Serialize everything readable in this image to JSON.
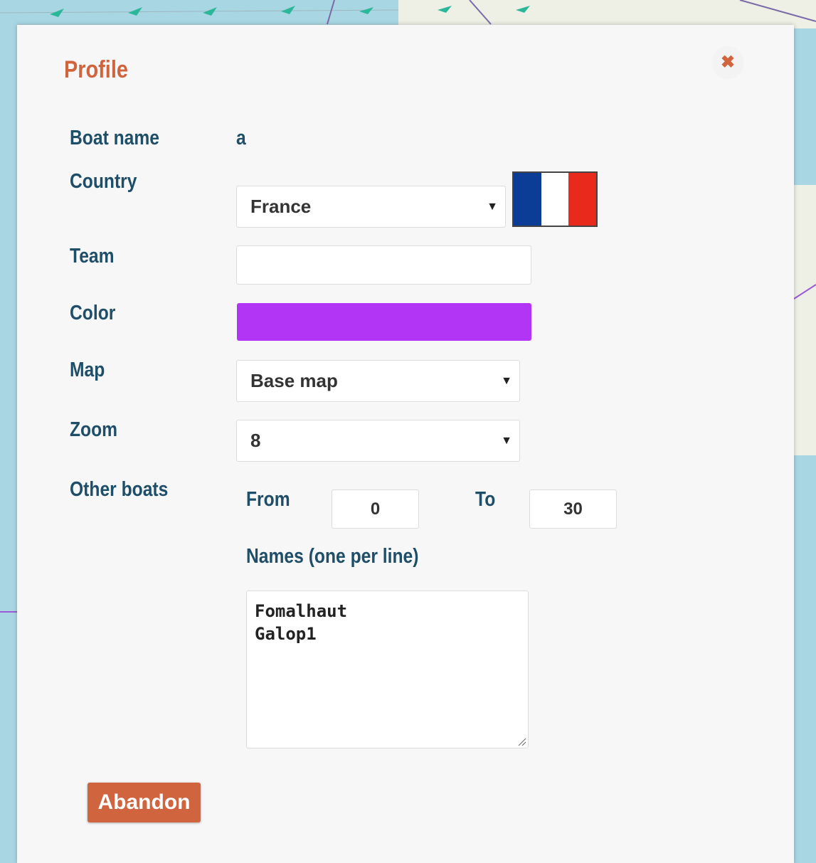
{
  "colors": {
    "accent": "#d0643f",
    "label": "#1f4e68",
    "boat_color": "#b235f5",
    "flag_blue": "#0b3c96",
    "flag_white": "#ffffff",
    "flag_red": "#e8291c"
  },
  "modal": {
    "title": "Profile",
    "close_icon": "close-icon",
    "close_glyph": "✖"
  },
  "fields": {
    "boat_name": {
      "label": "Boat name",
      "value": "a"
    },
    "country": {
      "label": "Country",
      "value": "France",
      "flag_icon": "france-flag"
    },
    "team": {
      "label": "Team",
      "value": ""
    },
    "color": {
      "label": "Color"
    },
    "map": {
      "label": "Map",
      "value": "Base map"
    },
    "zoom": {
      "label": "Zoom",
      "value": "8"
    },
    "other_boats": {
      "label": "Other boats",
      "from_label": "From",
      "from_value": "0",
      "to_label": "To",
      "to_value": "30",
      "names_label": "Names (one per line)",
      "names": [
        "Fomalhaut",
        "Galop1"
      ]
    }
  },
  "caret_glyph": "▼",
  "abandon_label": "Abandon"
}
